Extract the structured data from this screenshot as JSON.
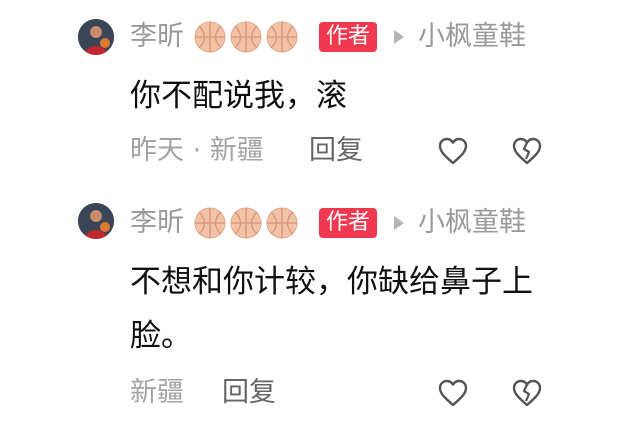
{
  "colors": {
    "author_tag_bg": "#f0394e",
    "meta_gray": "#a3a3a3",
    "content_black": "#111111",
    "reply_gray": "#666666"
  },
  "icons": {
    "badge": "basketball-icon",
    "like": "heart-outline-icon",
    "dislike": "broken-heart-icon",
    "reply_to": "triangle-right-icon"
  },
  "comments": [
    {
      "user_name": "李昕",
      "author_tag": "作者",
      "reply_to": "小枫童鞋",
      "content": "你不配说我，滚",
      "meta": "昨天 · 新疆",
      "reply_label": "回复"
    },
    {
      "user_name": "李昕",
      "author_tag": "作者",
      "reply_to": "小枫童鞋",
      "content": "不想和你计较，你缺给鼻子上脸。",
      "meta": "新疆",
      "reply_label": "回复"
    }
  ]
}
